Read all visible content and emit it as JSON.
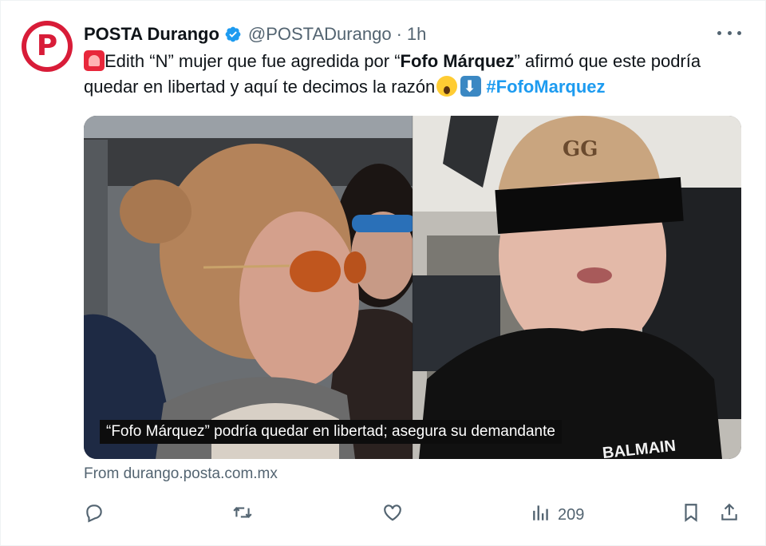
{
  "tweet": {
    "author_name": "POSTA Durango",
    "handle": "@POSTADurango",
    "separator": "·",
    "time": "1h",
    "avatar_letter": "P",
    "avatar_color": "#d81c38",
    "text": {
      "part1": "Edith “N” mujer que fue agredida por “",
      "bold": "Fofo Márquez",
      "part2": "” afirmó que este podría quedar en libertad y aquí te decimos la razón",
      "hashtag": "#FofoMarquez"
    },
    "emojis": [
      "police-light-emoji",
      "screaming-face-emoji",
      "down-arrow-emoji"
    ],
    "media_caption": "“Fofo Márquez” podría quedar en libertad; asegura su demandante",
    "media_cap_text": "BALMAIN",
    "source": "From durango.posta.com.mx",
    "views_count": "209"
  },
  "icons": {
    "verified": "verified-badge-icon",
    "more": "more-icon",
    "reply": "reply-icon",
    "retweet": "retweet-icon",
    "like": "like-icon",
    "views": "views-icon",
    "bookmark": "bookmark-icon",
    "share": "share-icon"
  },
  "colors": {
    "link": "#1d9bf0",
    "secondary_text": "#536471",
    "verified_blue": "#1d9bf0"
  }
}
